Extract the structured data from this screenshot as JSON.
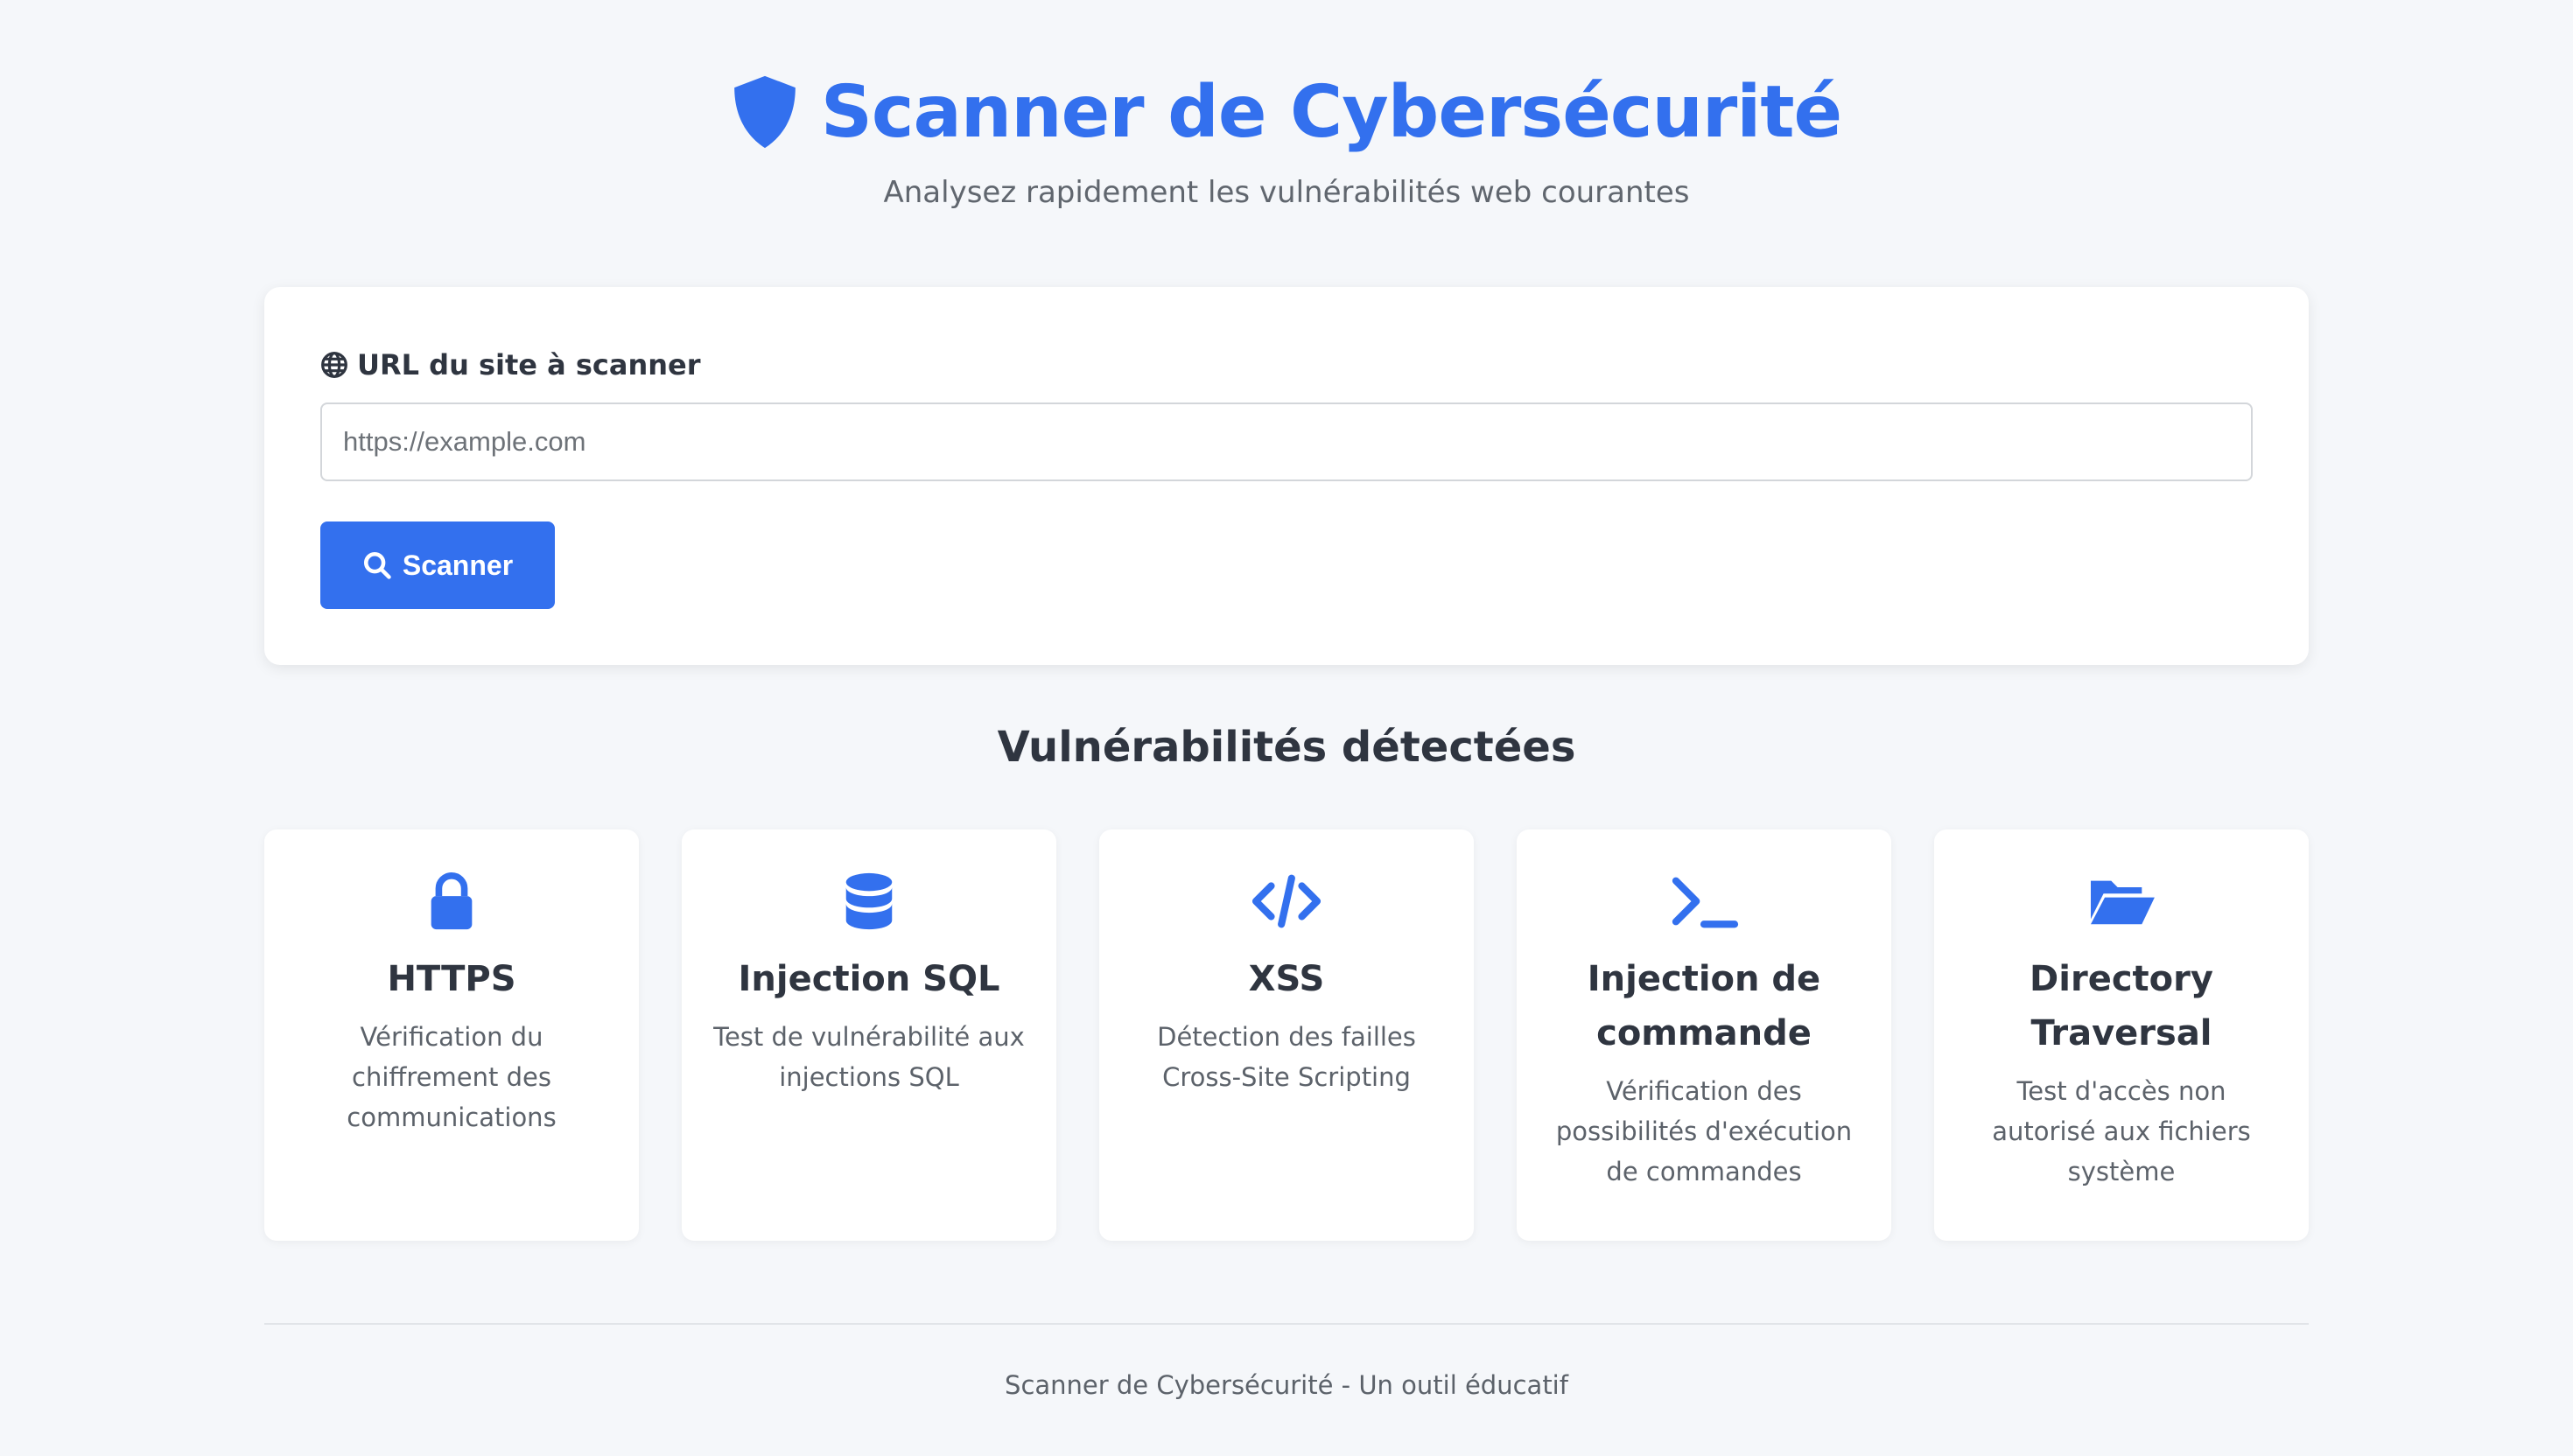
{
  "header": {
    "title": "Scanner de Cybersécurité",
    "subtitle": "Analysez rapidement les vulnérabilités web courantes"
  },
  "form": {
    "label": "URL du site à scanner",
    "url_placeholder": "https://example.com",
    "url_value": "",
    "scan_button": "Scanner"
  },
  "section": {
    "title": "Vulnérabilités détectées"
  },
  "checks": [
    {
      "icon": "lock-icon",
      "title": "HTTPS",
      "desc": "Vérification du chiffrement des communications"
    },
    {
      "icon": "database-icon",
      "title": "Injection SQL",
      "desc": "Test de vulnérabilité aux injections SQL"
    },
    {
      "icon": "code-icon",
      "title": "XSS",
      "desc": "Détection des failles Cross-Site Scripting"
    },
    {
      "icon": "terminal-icon",
      "title": "Injection de commande",
      "desc": "Vérification des possibilités d'exécution de commandes"
    },
    {
      "icon": "folder-open-icon",
      "title": "Directory Traversal",
      "desc": "Test d'accès non autorisé aux fichiers système"
    }
  ],
  "footer": {
    "text": "Scanner de Cybersécurité - Un outil éducatif"
  },
  "colors": {
    "accent": "#3370ee",
    "background": "#f5f7fa",
    "text": "#2f3540",
    "muted": "#5c626a"
  }
}
